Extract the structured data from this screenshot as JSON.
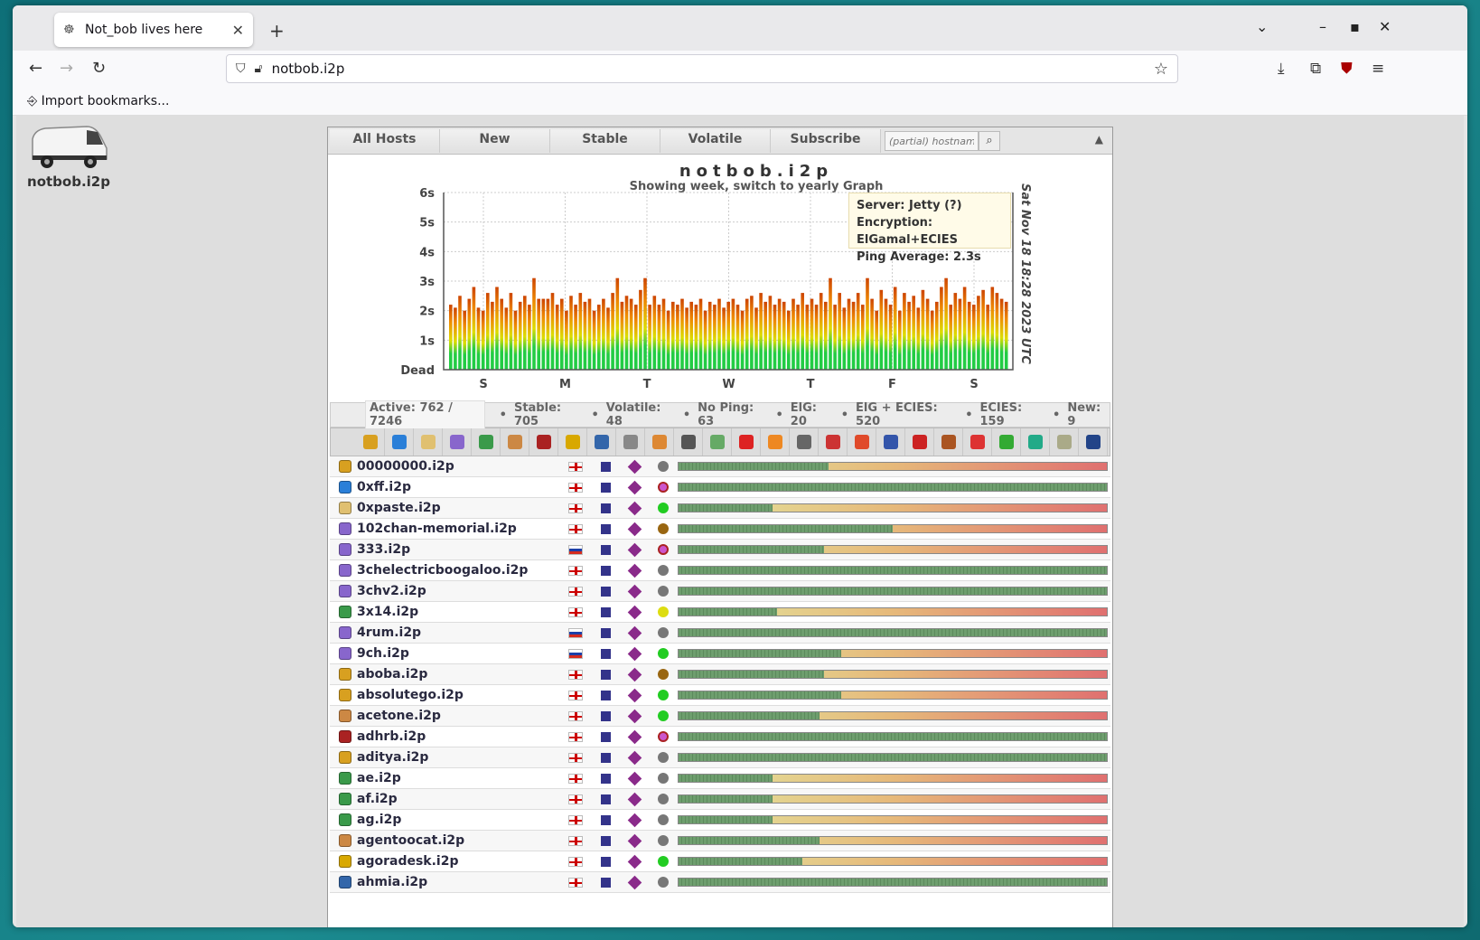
{
  "browser": {
    "tab_title": "Not_bob lives here",
    "url": "notbob.i2p",
    "import_bookmarks": "Import bookmarks..."
  },
  "site": {
    "logo_label": "notbob.i2p",
    "nav_tabs": [
      "All Hosts",
      "New",
      "Stable",
      "Volatile",
      "Subscribe"
    ],
    "search_placeholder": "(partial) hostname",
    "graph_title": "notbob.i2p",
    "graph_subtitle": "Showing week, switch to yearly Graph",
    "graph_date": "Sat Nov 18 18:28 2023 UTC",
    "tooltip": {
      "server": "Server: Jetty (?)",
      "encryption": "Encryption: ElGamal+ECIES",
      "ping": "Ping Average: 2.3s"
    },
    "stats": {
      "active": "Active: 762 / 7246",
      "stable": "Stable: 705",
      "volatile": "Volatile: 48",
      "noping": "No Ping: 63",
      "elg": "ElG: 20",
      "elg_ecies": "ElG + ECIES: 520",
      "ecies": "ECIES: 159",
      "new": "New: 9"
    }
  },
  "chart_data": {
    "type": "bar",
    "title": "notbob.i2p",
    "subtitle": "Showing week, switch to yearly Graph",
    "ytick_labels": [
      "Dead",
      "1s",
      "2s",
      "3s",
      "4s",
      "5s",
      "6s"
    ],
    "xtick_labels": [
      "S",
      "M",
      "T",
      "W",
      "T",
      "F",
      "S"
    ],
    "ylim": [
      0,
      6
    ],
    "values": [
      2.2,
      2.1,
      2.5,
      2.0,
      2.4,
      2.8,
      2.1,
      2.0,
      2.6,
      2.3,
      2.8,
      2.4,
      2.1,
      2.6,
      2.0,
      2.3,
      2.5,
      2.2,
      3.1,
      2.4,
      2.4,
      2.4,
      2.6,
      2.2,
      2.4,
      2.0,
      2.5,
      2.2,
      2.6,
      2.3,
      2.4,
      2.0,
      2.2,
      2.4,
      2.1,
      2.6,
      3.1,
      2.3,
      2.5,
      2.4,
      2.2,
      2.7,
      3.1,
      2.2,
      2.5,
      2.2,
      2.4,
      2.0,
      2.3,
      2.2,
      2.4,
      2.1,
      2.3,
      2.2,
      2.4,
      2.0,
      2.3,
      2.2,
      2.4,
      2.1,
      2.3,
      2.4,
      2.2,
      2.0,
      2.4,
      2.5,
      2.1,
      2.6,
      2.3,
      2.5,
      2.2,
      2.4,
      2.3,
      2.0,
      2.4,
      2.2,
      2.6,
      2.2,
      2.4,
      2.2,
      2.6,
      2.3,
      3.1,
      2.2,
      2.6,
      2.1,
      2.4,
      2.3,
      2.6,
      2.2,
      3.1,
      2.4,
      2.0,
      2.7,
      2.4,
      2.2,
      2.8,
      2.0,
      2.6,
      2.3,
      2.5,
      2.1,
      2.7,
      2.4,
      2.0,
      2.3,
      2.8,
      3.1,
      2.2,
      2.6,
      2.4,
      2.8,
      2.3,
      2.2,
      2.5,
      2.7,
      2.2,
      2.8,
      2.6,
      2.4,
      2.3
    ],
    "colors": [
      "#22cc44",
      "#dddd00",
      "#ee8800",
      "#cc4400"
    ]
  },
  "categories": [
    {
      "name": "hacking-icon",
      "color": "#d8a020"
    },
    {
      "name": "upload-icon",
      "color": "#2a7fd8"
    },
    {
      "name": "paste-icon",
      "color": "#e0c070"
    },
    {
      "name": "imageboard-icon",
      "color": "#8866cc"
    },
    {
      "name": "globe-icon",
      "color": "#3a9a4a"
    },
    {
      "name": "user-icon",
      "color": "#cc8844"
    },
    {
      "name": "hand-icon",
      "color": "#aa2222"
    },
    {
      "name": "dollar-icon",
      "color": "#d8a800"
    },
    {
      "name": "magnifier-icon",
      "color": "#3366aa"
    },
    {
      "name": "satellite-icon",
      "color": "#888888"
    },
    {
      "name": "stats-icon",
      "color": "#dd8833"
    },
    {
      "name": "gamepad-icon",
      "color": "#555555"
    },
    {
      "name": "image-icon",
      "color": "#66aa66"
    },
    {
      "name": "alert-icon",
      "color": "#dd2222"
    },
    {
      "name": "package-icon",
      "color": "#ee8822"
    },
    {
      "name": "wrench-icon",
      "color": "#666666"
    },
    {
      "name": "books-icon",
      "color": "#cc3333"
    },
    {
      "name": "git-icon",
      "color": "#e04a2a"
    },
    {
      "name": "pen-icon",
      "color": "#3355aa"
    },
    {
      "name": "magnet-icon",
      "color": "#cc2222"
    },
    {
      "name": "video-icon",
      "color": "#aa5522"
    },
    {
      "name": "lifering-icon",
      "color": "#dd3333"
    },
    {
      "name": "leaf-icon",
      "color": "#33aa33"
    },
    {
      "name": "recycle-icon",
      "color": "#22aa88"
    },
    {
      "name": "i2p-icon",
      "color": "#aaaa88"
    },
    {
      "name": "terminal-icon",
      "color": "#224488"
    }
  ],
  "hosts": [
    {
      "name": "00000000.i2p",
      "cat": "#d8a020",
      "flag": "uk",
      "dot": "grey",
      "fill": 35
    },
    {
      "name": "0xff.i2p",
      "cat": "#2a7fd8",
      "flag": "uk",
      "dot": "pink",
      "fill": 100
    },
    {
      "name": "0xpaste.i2p",
      "cat": "#e0c070",
      "flag": "uk",
      "dot": "green",
      "fill": 22
    },
    {
      "name": "102chan-memorial.i2p",
      "cat": "#8866cc",
      "flag": "uk",
      "dot": "brown",
      "fill": 50
    },
    {
      "name": "333.i2p",
      "cat": "#8866cc",
      "flag": "ru",
      "dot": "pink",
      "fill": 34
    },
    {
      "name": "3chelectricboogaloo.i2p",
      "cat": "#8866cc",
      "flag": "uk",
      "dot": "grey",
      "fill": 100
    },
    {
      "name": "3chv2.i2p",
      "cat": "#8866cc",
      "flag": "uk",
      "dot": "grey",
      "fill": 100
    },
    {
      "name": "3x14.i2p",
      "cat": "#3a9a4a",
      "flag": "uk",
      "dot": "yellow",
      "fill": 23
    },
    {
      "name": "4rum.i2p",
      "cat": "#8866cc",
      "flag": "ru",
      "dot": "grey",
      "fill": 100
    },
    {
      "name": "9ch.i2p",
      "cat": "#8866cc",
      "flag": "ru",
      "dot": "green",
      "fill": 38
    },
    {
      "name": "aboba.i2p",
      "cat": "#d8a020",
      "flag": "uk",
      "dot": "brown",
      "fill": 34
    },
    {
      "name": "absolutego.i2p",
      "cat": "#d8a020",
      "flag": "uk",
      "dot": "green",
      "fill": 38
    },
    {
      "name": "acetone.i2p",
      "cat": "#cc8844",
      "flag": "uk",
      "dot": "green",
      "fill": 33
    },
    {
      "name": "adhrb.i2p",
      "cat": "#aa2222",
      "flag": "uk",
      "dot": "pink",
      "fill": 100
    },
    {
      "name": "aditya.i2p",
      "cat": "#d8a020",
      "flag": "uk",
      "dot": "grey",
      "fill": 100
    },
    {
      "name": "ae.i2p",
      "cat": "#3a9a4a",
      "flag": "uk",
      "dot": "grey",
      "fill": 22
    },
    {
      "name": "af.i2p",
      "cat": "#3a9a4a",
      "flag": "uk",
      "dot": "grey",
      "fill": 22
    },
    {
      "name": "ag.i2p",
      "cat": "#3a9a4a",
      "flag": "uk",
      "dot": "grey",
      "fill": 22
    },
    {
      "name": "agentoocat.i2p",
      "cat": "#cc8844",
      "flag": "uk",
      "dot": "grey",
      "fill": 33
    },
    {
      "name": "agoradesk.i2p",
      "cat": "#d8a800",
      "flag": "uk",
      "dot": "green",
      "fill": 29
    },
    {
      "name": "ahmia.i2p",
      "cat": "#3366aa",
      "flag": "uk",
      "dot": "grey",
      "fill": 100
    }
  ]
}
